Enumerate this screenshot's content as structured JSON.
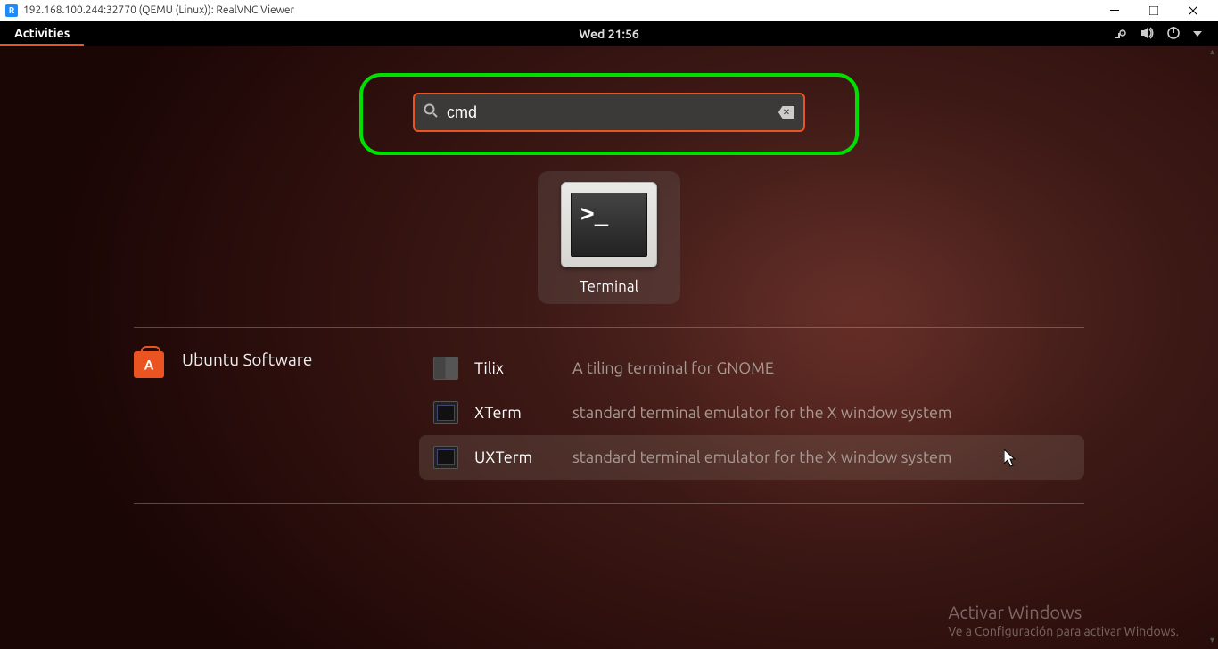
{
  "window": {
    "title": "192.168.100.244:32770 (QEMU (Linux)): RealVNC Viewer"
  },
  "topbar": {
    "activities": "Activities",
    "clock": "Wed 21:56"
  },
  "search": {
    "value": "cmd"
  },
  "app_result": {
    "label": "Terminal",
    "prompt": ">_"
  },
  "software": {
    "header": "Ubuntu Software",
    "items": [
      {
        "name": "Tilix",
        "desc": "A tiling terminal for GNOME"
      },
      {
        "name": "XTerm",
        "desc": "standard terminal emulator for the X window system"
      },
      {
        "name": "UXTerm",
        "desc": "standard terminal emulator for the X window system"
      }
    ]
  },
  "watermark": {
    "line1": "Activar Windows",
    "line2": "Ve a Configuración para activar Windows."
  }
}
